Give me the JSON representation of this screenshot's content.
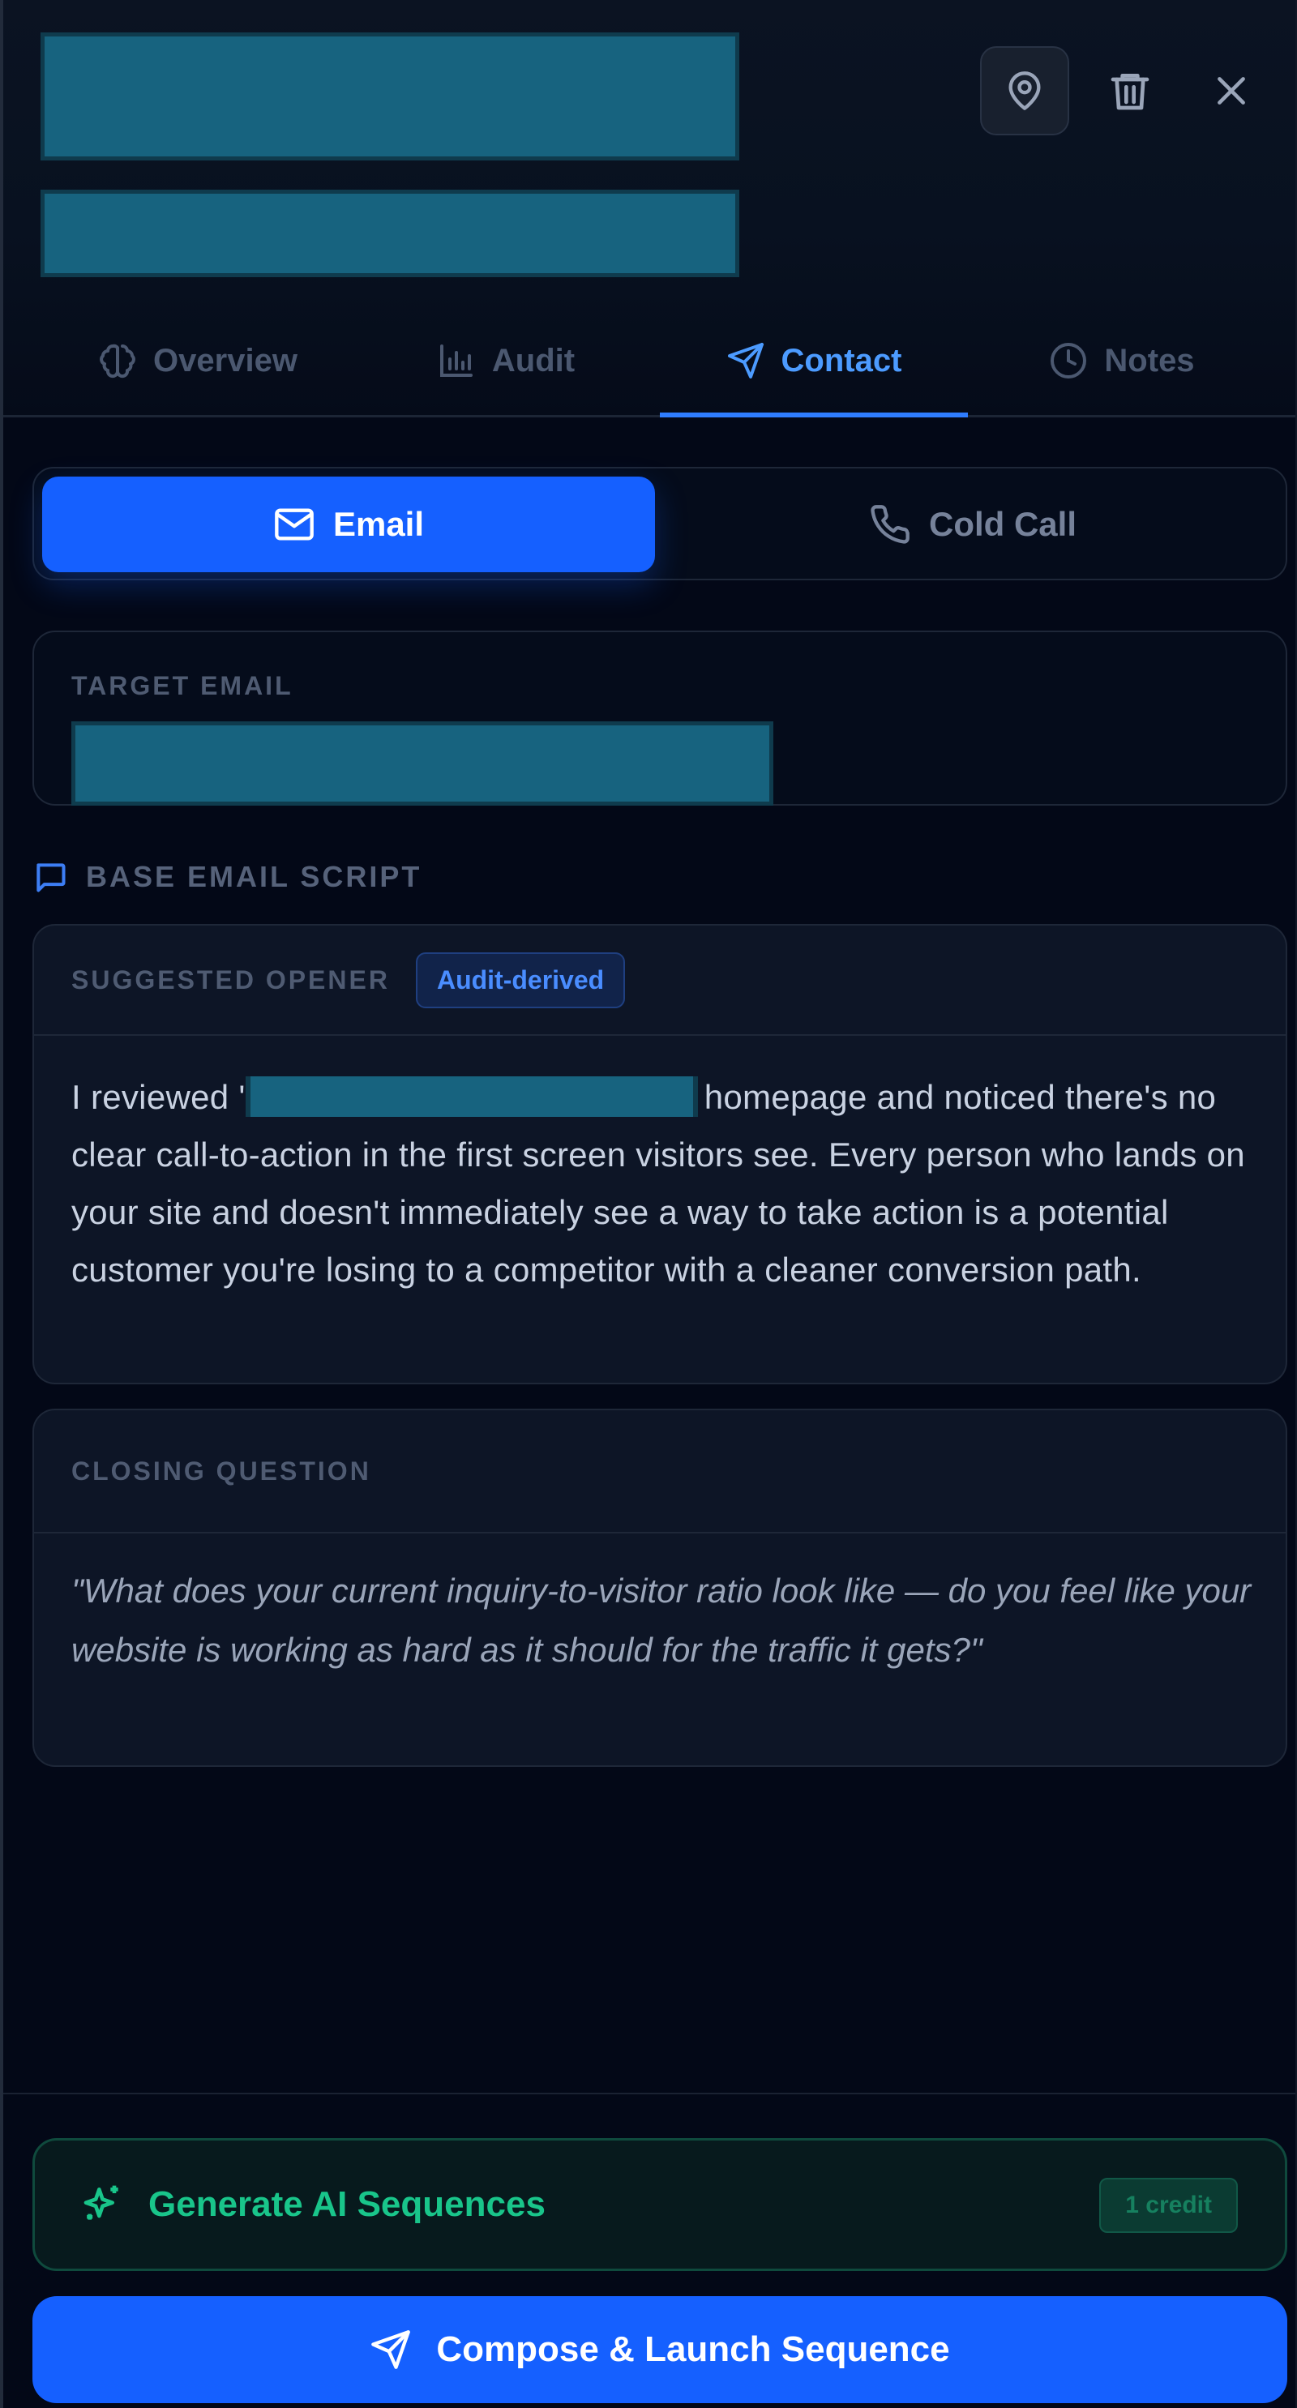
{
  "tabs": [
    {
      "label": "Overview",
      "icon": "brain-icon",
      "active": false
    },
    {
      "label": "Audit",
      "icon": "bar-chart-icon",
      "active": false
    },
    {
      "label": "Contact",
      "icon": "send-icon",
      "active": true
    },
    {
      "label": "Notes",
      "icon": "clock-icon",
      "active": false
    }
  ],
  "header": {
    "buttons": [
      "map-pin-icon",
      "trash-icon",
      "close-icon"
    ]
  },
  "channel_toggle": {
    "email_label": "Email",
    "cold_call_label": "Cold Call",
    "selected": "Email"
  },
  "target_email": {
    "label": "TARGET EMAIL"
  },
  "script_section": {
    "title": "BASE EMAIL SCRIPT",
    "opener": {
      "label": "SUGGESTED OPENER",
      "badge": "Audit-derived",
      "text_prefix": "I reviewed '",
      "text_suffix": "homepage and noticed there's no clear call-to-action in the first screen visitors see. Every person who lands on your site and doesn't immediately see a way to take action is a potential customer you're losing to a competitor with a cleaner conversion path."
    },
    "closing": {
      "label": "CLOSING QUESTION",
      "text": "\"What does your current inquiry-to-visitor ratio look like — do you feel like your website is working as hard as it should for the traffic it gets?\""
    }
  },
  "actions": {
    "generate_label": "Generate AI Sequences",
    "credit_badge": "1 credit",
    "launch_label": "Compose & Launch Sequence"
  },
  "colors": {
    "background": "#030817",
    "accent": "#1560ff",
    "active_tab": "#4c9bff",
    "success": "#19c58a",
    "redaction": "#17637f"
  }
}
